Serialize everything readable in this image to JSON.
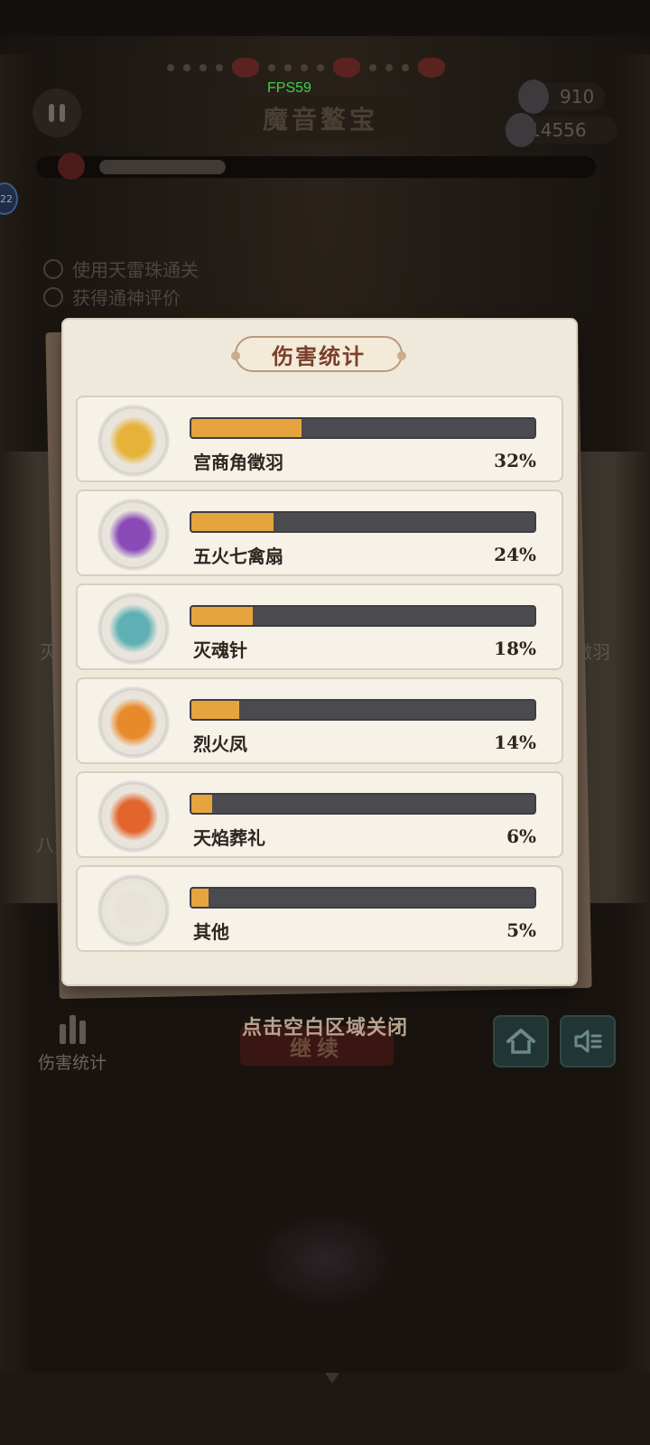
{
  "hud": {
    "fps": "FPS59",
    "level_title": "魔音鳌宝",
    "currency_1": "910",
    "currency_2": "14556",
    "side_badge": "22"
  },
  "quests": [
    {
      "text": "使用天雷珠通关"
    },
    {
      "text": "获得通神评价"
    }
  ],
  "background_labels": {
    "weapon_left": "灭",
    "weapon_left2": "八方",
    "weapon_right": "徵羽"
  },
  "modal": {
    "title": "伤害统计",
    "rows": [
      {
        "name": "宫商角徵羽",
        "percent_label": "32%",
        "percent": 32,
        "icon": "golden-palace-icon",
        "color": "#e6b23a"
      },
      {
        "name": "五火七禽扇",
        "percent_label": "24%",
        "percent": 24,
        "icon": "purple-fan-icon",
        "color": "#8a4bb8"
      },
      {
        "name": "灭魂针",
        "percent_label": "18%",
        "percent": 18,
        "icon": "soul-needles-icon",
        "color": "#5fb0b4"
      },
      {
        "name": "烈火凤",
        "percent_label": "14%",
        "percent": 14,
        "icon": "fire-phoenix-icon",
        "color": "#e88a2a"
      },
      {
        "name": "天焰葬礼",
        "percent_label": "6%",
        "percent": 6,
        "icon": "flame-burial-icon",
        "color": "#e2652e"
      },
      {
        "name": "其他",
        "percent_label": "5%",
        "percent": 5,
        "icon": "empty-slot-icon",
        "color": "#e7e3db"
      }
    ]
  },
  "footer": {
    "close_hint": "点击空白区域关闭",
    "continue_label": "继续",
    "stats_label": "伤害统计"
  },
  "colors": {
    "bar_fill": "#e6a43e",
    "bar_track": "#4b4a4e",
    "fps_green": "#3fd14a"
  }
}
